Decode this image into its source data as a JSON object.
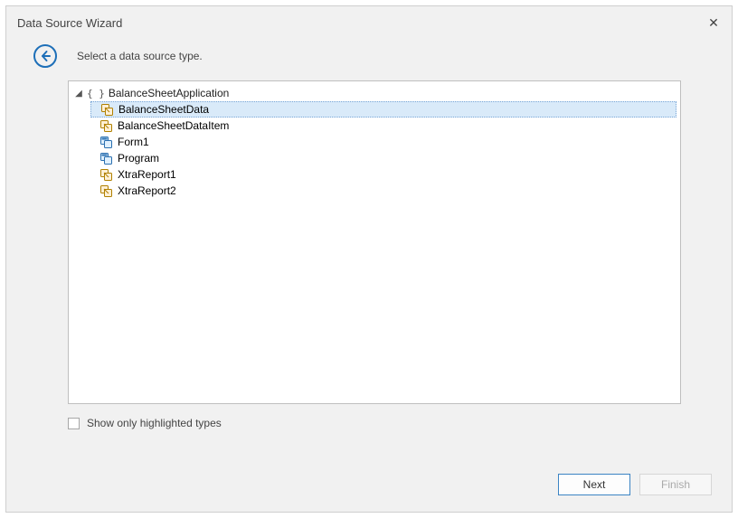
{
  "window": {
    "title": "Data Source Wizard"
  },
  "header": {
    "instruction": "Select a data source type."
  },
  "tree": {
    "root_label": "BalanceSheetApplication",
    "expanded": true,
    "children": [
      {
        "label": "BalanceSheetData",
        "icon": "class-icon",
        "selected": true
      },
      {
        "label": "BalanceSheetDataItem",
        "icon": "class-icon",
        "selected": false
      },
      {
        "label": "Form1",
        "icon": "form-icon",
        "selected": false
      },
      {
        "label": "Program",
        "icon": "form-icon",
        "selected": false
      },
      {
        "label": "XtraReport1",
        "icon": "class-icon",
        "selected": false
      },
      {
        "label": "XtraReport2",
        "icon": "class-icon",
        "selected": false
      }
    ]
  },
  "options": {
    "show_only_highlighted_label": "Show only highlighted types",
    "show_only_highlighted_checked": false
  },
  "buttons": {
    "next": "Next",
    "finish": "Finish"
  },
  "icons": {
    "close_glyph": "✕",
    "expand_glyph": "◢",
    "braces_glyph": "{ }"
  }
}
